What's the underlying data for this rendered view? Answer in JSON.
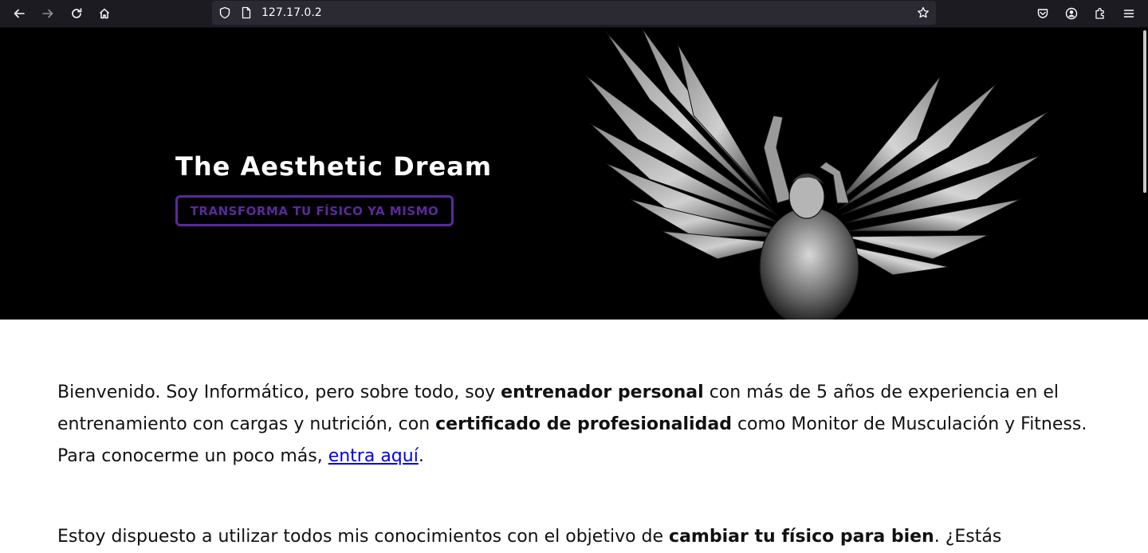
{
  "browser": {
    "url": "127.17.0.2",
    "icons": {
      "back": "arrow-left-icon",
      "forward": "arrow-right-icon",
      "reload": "reload-icon",
      "home": "home-icon",
      "site_info": "shield-icon",
      "page": "page-icon",
      "bookmark": "star-icon",
      "pocket": "pocket-icon",
      "account": "account-icon",
      "extensions": "puzzle-icon",
      "menu": "hamburger-menu-icon"
    },
    "colors": {
      "toolbar": "#1c1b22",
      "urlbar": "#2b2a33"
    }
  },
  "hero": {
    "title": "The Aesthetic Dream",
    "cta_label": "TRANSFORMA TU FÍSICO YA MISMO",
    "image": "winged-bodybuilder-illustration",
    "colors": {
      "background": "#000000",
      "accent": "#5b2a9a"
    }
  },
  "intro": {
    "p1": {
      "t1": "Bienvenido. Soy Informático, pero sobre todo, soy ",
      "b1": "entrenador personal",
      "t2": " con más de 5 años de experiencia en el entrenamiento con cargas y nutrición, con ",
      "b2": "certificado de profesionalidad",
      "t3": " como Monitor de Musculación y Fitness. Para conocerme un poco más, ",
      "link": "entra aquí",
      "t4": "."
    },
    "p2": {
      "t1": "Estoy dispuesto a utilizar todos mis conocimientos con el objetivo de ",
      "b1": "cambiar tu físico para bien",
      "t2": ". ¿Estás"
    }
  }
}
